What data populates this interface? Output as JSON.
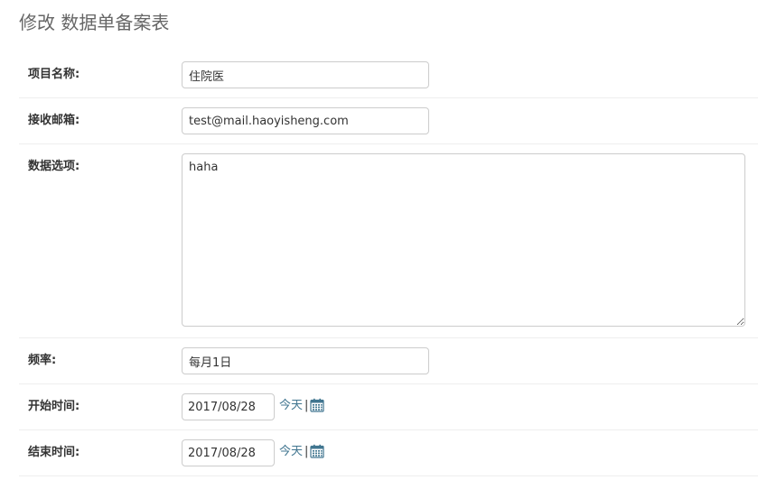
{
  "page": {
    "title": "修改 数据单备案表"
  },
  "form": {
    "project_name": {
      "label": "项目名称:",
      "value": "住院医"
    },
    "email": {
      "label": "接收邮箱:",
      "value": "test@mail.haoyisheng.com"
    },
    "data_options": {
      "label": "数据选项:",
      "value": "haha"
    },
    "frequency": {
      "label": "频率:",
      "value": "每月1日"
    },
    "start_time": {
      "label": "开始时间:",
      "value": "2017/08/28",
      "today_label": "今天",
      "separator": "|"
    },
    "end_time": {
      "label": "结束时间:",
      "value": "2017/08/28",
      "today_label": "今天",
      "separator": "|"
    }
  },
  "icons": {
    "calendar": "calendar-icon"
  },
  "colors": {
    "link": "#417690",
    "title": "#666666",
    "border": "#cccccc"
  }
}
